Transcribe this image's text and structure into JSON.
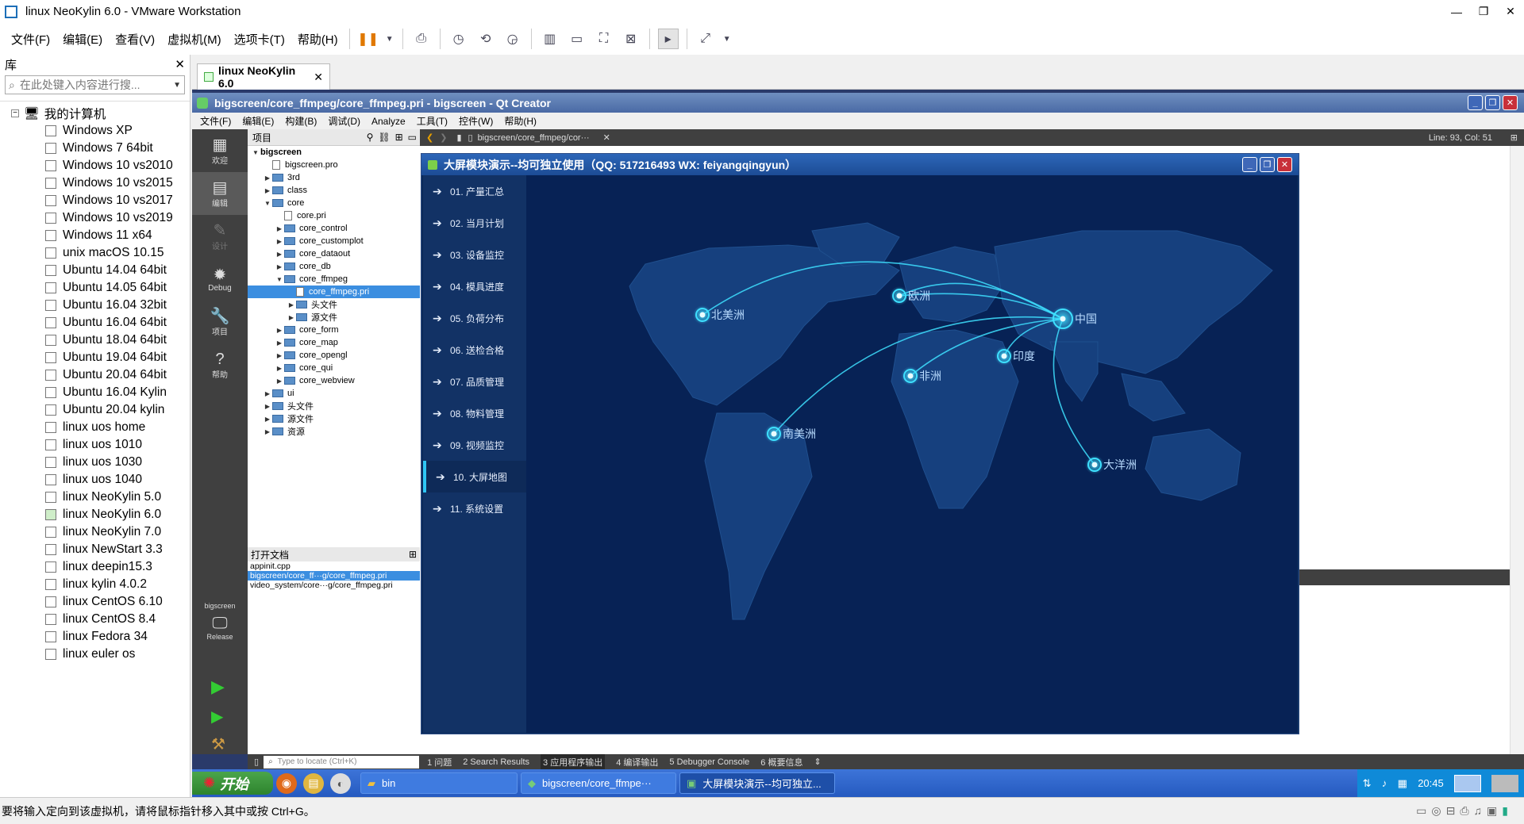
{
  "vmware": {
    "title": "linux NeoKylin 6.0 - VMware Workstation",
    "menu": [
      "文件(F)",
      "编辑(E)",
      "查看(V)",
      "虚拟机(M)",
      "选项卡(T)",
      "帮助(H)"
    ],
    "window_controls": [
      "—",
      "❐",
      "✕"
    ]
  },
  "library": {
    "title": "库",
    "close": "✕",
    "search_placeholder": "在此处键入内容进行搜...",
    "root": "我的计算机",
    "items": [
      "Windows XP",
      "Windows 7 64bit",
      "Windows 10 vs2010",
      "Windows 10 vs2015",
      "Windows 10 vs2017",
      "Windows 10 vs2019",
      "Windows 11 x64",
      "unix macOS 10.15",
      "Ubuntu 14.04 64bit",
      "Ubuntu 14.05 64bit",
      "Ubuntu 16.04 32bit",
      "Ubuntu 16.04 64bit",
      "Ubuntu 18.04 64bit",
      "Ubuntu 19.04 64bit",
      "Ubuntu 20.04 64bit",
      "Ubuntu 16.04 Kylin",
      "Ubuntu 20.04 kylin",
      "linux uos home",
      "linux uos 1010",
      "linux uos 1030",
      "linux uos 1040",
      "linux NeoKylin 5.0",
      "linux NeoKylin 6.0",
      "linux NeoKylin 7.0",
      "linux NewStart 3.3",
      "linux deepin15.3",
      "linux kylin 4.0.2",
      "linux CentOS 6.10",
      "linux CentOS 8.4",
      "linux Fedora 34",
      "linux euler os"
    ],
    "running": "linux NeoKylin 6.0"
  },
  "vm_tab": {
    "label": "linux NeoKylin 6.0",
    "close": "✕"
  },
  "qtcreator": {
    "title": "bigscreen/core_ffmpeg/core_ffmpeg.pri - bigscreen - Qt Creator",
    "menu": [
      "文件(F)",
      "编辑(E)",
      "构建(B)",
      "调试(D)",
      "Analyze",
      "工具(T)",
      "控件(W)",
      "帮助(H)"
    ],
    "modes": [
      {
        "icon": "▦",
        "label": "欢迎"
      },
      {
        "icon": "▤",
        "label": "编辑"
      },
      {
        "icon": "✎",
        "label": "设计"
      },
      {
        "icon": "✹",
        "label": "Debug"
      },
      {
        "icon": "🔧",
        "label": "项目"
      },
      {
        "icon": "?",
        "label": "帮助"
      }
    ],
    "kit": {
      "project": "bigscreen",
      "config": "Release"
    },
    "project_header": "项目",
    "tree": [
      {
        "label": "bigscreen",
        "depth": 0,
        "type": "root",
        "arrow": "▼"
      },
      {
        "label": "bigscreen.pro",
        "depth": 1,
        "type": "file",
        "arrow": ""
      },
      {
        "label": "3rd",
        "depth": 1,
        "type": "folder",
        "arrow": "▶"
      },
      {
        "label": "class",
        "depth": 1,
        "type": "folder",
        "arrow": "▶"
      },
      {
        "label": "core",
        "depth": 1,
        "type": "folder",
        "arrow": "▼"
      },
      {
        "label": "core.pri",
        "depth": 2,
        "type": "file",
        "arrow": ""
      },
      {
        "label": "core_control",
        "depth": 2,
        "type": "folder",
        "arrow": "▶"
      },
      {
        "label": "core_customplot",
        "depth": 2,
        "type": "folder",
        "arrow": "▶"
      },
      {
        "label": "core_dataout",
        "depth": 2,
        "type": "folder",
        "arrow": "▶"
      },
      {
        "label": "core_db",
        "depth": 2,
        "type": "folder",
        "arrow": "▶"
      },
      {
        "label": "core_ffmpeg",
        "depth": 2,
        "type": "folder",
        "arrow": "▼"
      },
      {
        "label": "core_ffmpeg.pri",
        "depth": 3,
        "type": "file",
        "arrow": "",
        "selected": true
      },
      {
        "label": "头文件",
        "depth": 3,
        "type": "folder",
        "arrow": "▶"
      },
      {
        "label": "源文件",
        "depth": 3,
        "type": "folder",
        "arrow": "▶"
      },
      {
        "label": "core_form",
        "depth": 2,
        "type": "folder",
        "arrow": "▶"
      },
      {
        "label": "core_map",
        "depth": 2,
        "type": "folder",
        "arrow": "▶"
      },
      {
        "label": "core_opengl",
        "depth": 2,
        "type": "folder",
        "arrow": "▶"
      },
      {
        "label": "core_qui",
        "depth": 2,
        "type": "folder",
        "arrow": "▶"
      },
      {
        "label": "core_webview",
        "depth": 2,
        "type": "folder",
        "arrow": "▶"
      },
      {
        "label": "ui",
        "depth": 1,
        "type": "folder",
        "arrow": "▶"
      },
      {
        "label": "头文件",
        "depth": 1,
        "type": "folder",
        "arrow": "▶"
      },
      {
        "label": "源文件",
        "depth": 1,
        "type": "folder",
        "arrow": "▶"
      },
      {
        "label": "资源",
        "depth": 1,
        "type": "folder",
        "arrow": "▶"
      }
    ],
    "open_docs_header": "打开文档",
    "open_docs": [
      "appinit.cpp",
      "bigscreen/core_ff···g/core_ffmpeg.pri",
      "video_system/core···g/core_ffmpeg.pri"
    ],
    "editor_file": "bigscreen/core_ffmpeg/cor···",
    "cursor_pos": "Line: 93, Col: 51",
    "locator_placeholder": "Type to locate (Ctrl+K)",
    "output_tabs": [
      "1 问题",
      "2 Search Results",
      "3 应用程序输出",
      "4 编译输出",
      "5 Debugger Console",
      "6 概要信息"
    ]
  },
  "app": {
    "title": "大屏模块演示--均可独立使用（QQ: 517216493  WX: feiyangqingyun）",
    "nav": [
      "01. 产量汇总",
      "02. 当月计划",
      "03. 设备监控",
      "04. 模具进度",
      "05. 负荷分布",
      "06. 送检合格",
      "07. 品质管理",
      "08. 物料管理",
      "09. 视频监控",
      "10. 大屏地图",
      "11. 系统设置"
    ],
    "active_nav": "10. 大屏地图",
    "map_labels": {
      "north_america": "北美洲",
      "europe": "欧洲",
      "china": "中国",
      "india": "印度",
      "africa": "非洲",
      "south_america": "南美洲",
      "oceania": "大洋洲"
    },
    "colors": {
      "background": "#072255",
      "land": "#16407e",
      "route": "#3ee0ff"
    }
  },
  "guest_taskbar": {
    "start": "开始",
    "tasks": [
      "bin",
      "bigscreen/core_ffmpe···",
      "大屏模块演示--均可独立..."
    ],
    "clock": "20:45"
  },
  "host_status": "要将输入定向到该虚拟机，请将鼠标指针移入其中或按 Ctrl+G。"
}
